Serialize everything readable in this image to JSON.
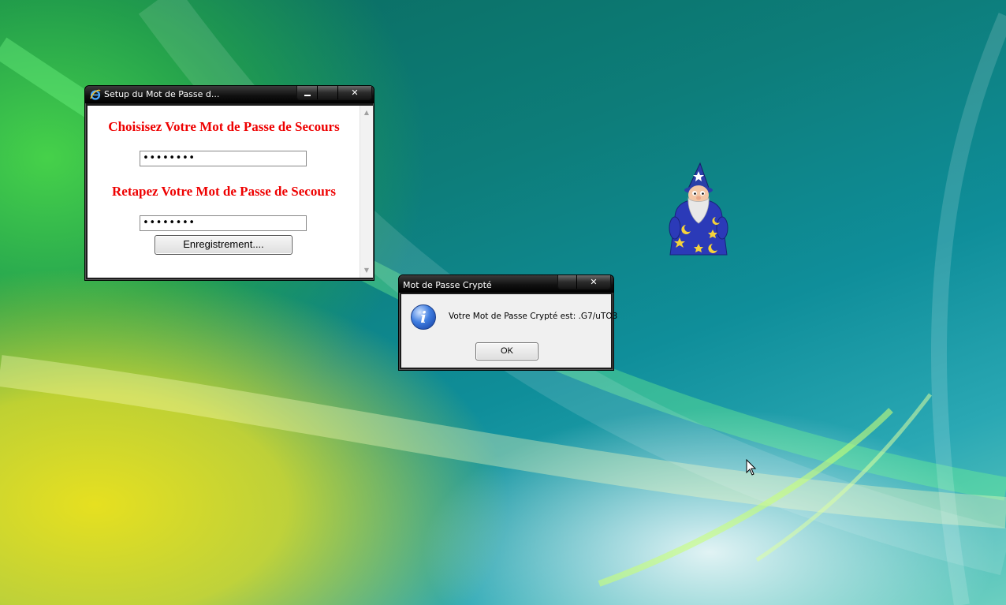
{
  "setup_window": {
    "title": "Setup du Mot de Passe d...",
    "heading_choose": "Choisisez Votre Mot de Passe de Secours",
    "password1": "••••••••",
    "heading_retype": "Retapez Votre Mot de Passe de Secours",
    "password2": "••••••••",
    "save_button": "Enregistrement....",
    "minimize": "▁",
    "close": "✕"
  },
  "message_box": {
    "title": "Mot de Passe Crypté",
    "message": "Votre Mot de Passe Crypté est: .G7/uTO3",
    "ok_button": "OK",
    "close": "✕",
    "icon_glyph": "i"
  },
  "icons": {
    "app_icon": "ie-icon",
    "info_icon": "information-icon",
    "assistant": "wizard-assistant-icon",
    "cursor": "mouse-cursor-icon"
  },
  "colors": {
    "heading_red": "#e00000",
    "title_bar": "#1c1c1c"
  }
}
